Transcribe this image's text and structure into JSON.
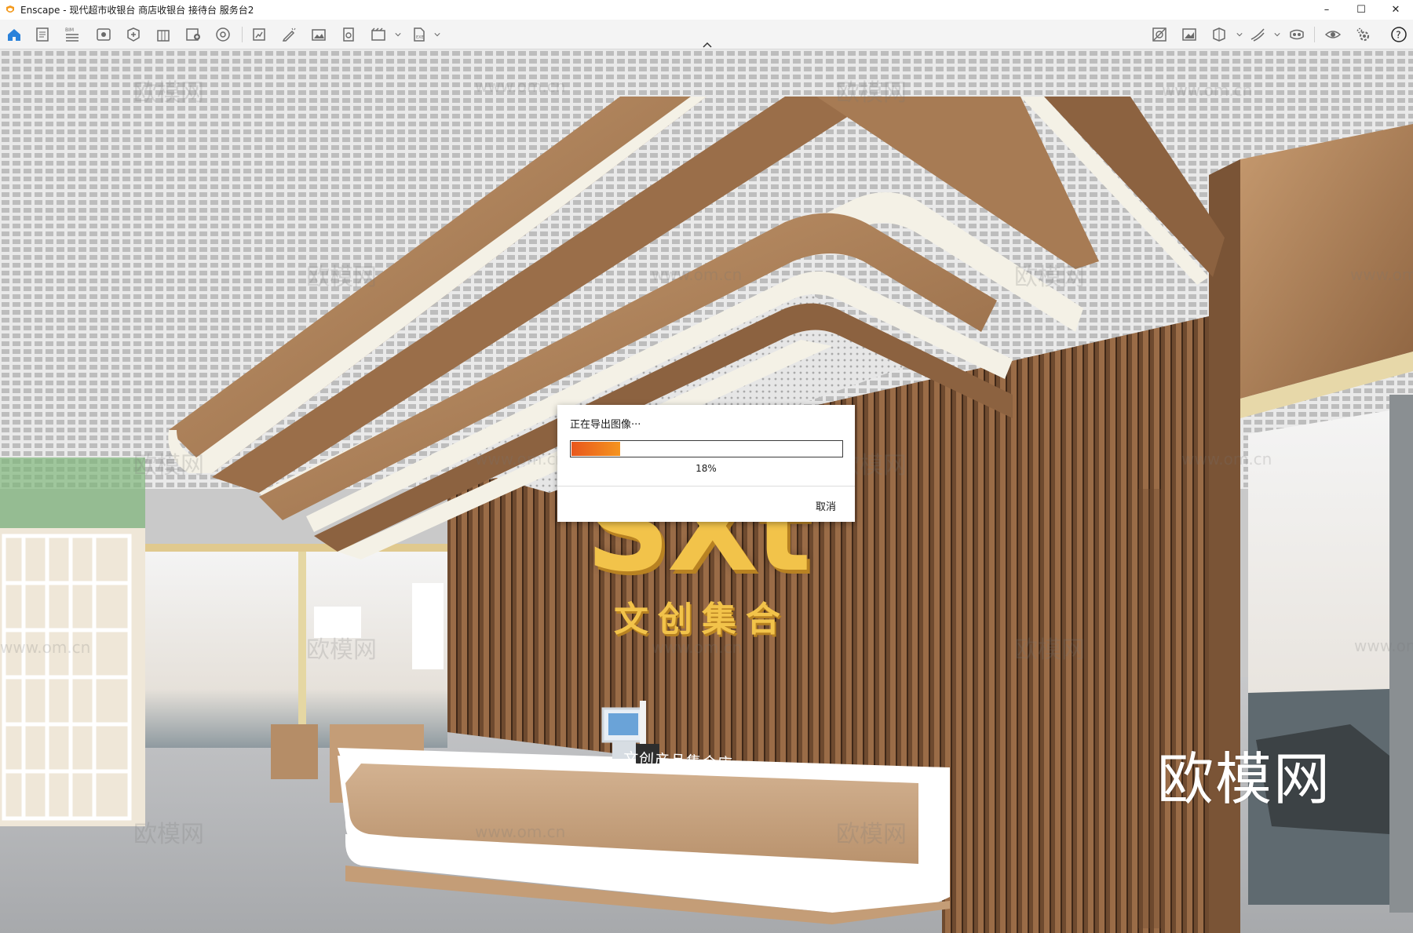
{
  "window": {
    "title": "Enscape - 现代超市收银台 商店收银台 接待台 服务台2",
    "controls": {
      "minimize": "–",
      "maximize": "☐",
      "close": "✕"
    }
  },
  "toolbar": {
    "left_icons": [
      "home-icon",
      "document-icon",
      "bim-list-icon",
      "view-eye-icon",
      "asset-icon",
      "building-icon",
      "upload-icon",
      "material-icon",
      "batch-render-icon",
      "annotate-icon",
      "image-icon",
      "screenshot-export-icon",
      "video-export-icon",
      "export-file-icon"
    ],
    "bim_badge": "BIM",
    "right_icons": [
      "hide-view-icon",
      "image-view-icon",
      "section-icon",
      "draw-icon",
      "vr-icon",
      "visibility-icon",
      "settings-icon",
      "help-icon"
    ],
    "colors": {
      "home_active": "#2a82da",
      "icon": "#6a6a6a"
    }
  },
  "scene": {
    "watermark": "欧模网",
    "watermark_url": "www.om.cn",
    "big_watermark": "欧模网",
    "sign_logo": "SXt",
    "sign_subtitle": "文创集合",
    "counter_text": "文创产品集合店"
  },
  "dialog": {
    "title": "正在导出图像···",
    "progress": 0.18,
    "progress_label": "18%",
    "cancel_label": "取消",
    "colors": {
      "fill_start": "#e8571d",
      "fill_end": "#f5941f"
    }
  }
}
